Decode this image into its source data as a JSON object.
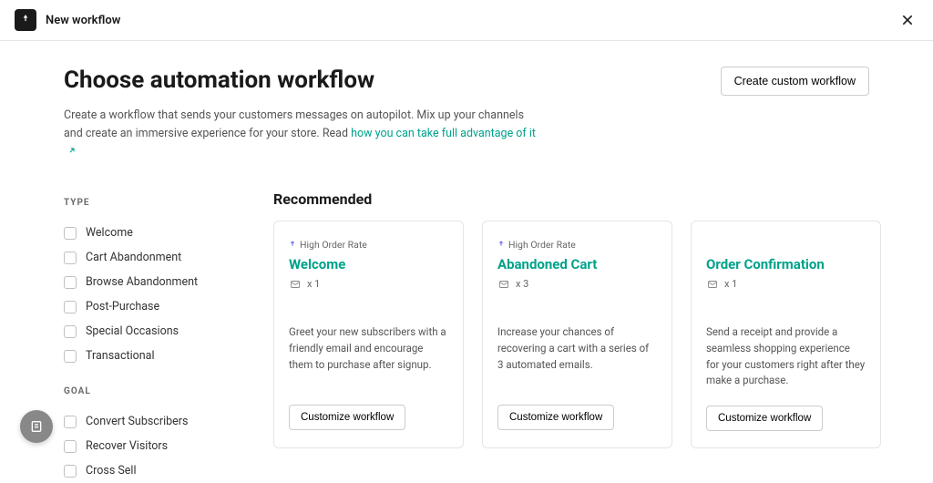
{
  "topbar": {
    "title": "New workflow"
  },
  "header": {
    "title": "Choose automation workflow",
    "desc_prefix": "Create a workflow that sends your customers messages on autopilot. Mix up your channels and create an immersive experience for your store. Read ",
    "link_text": "how you can take full advantage of it",
    "create_btn": "Create custom workflow"
  },
  "sidebar": {
    "type_heading": "TYPE",
    "goal_heading": "GOAL",
    "type_items": [
      "Welcome",
      "Cart Abandonment",
      "Browse Abandonment",
      "Post-Purchase",
      "Special Occasions",
      "Transactional"
    ],
    "goal_items": [
      "Convert Subscribers",
      "Recover Visitors",
      "Cross Sell"
    ]
  },
  "main": {
    "section_heading": "Recommended",
    "cards": [
      {
        "badge": "High Order Rate",
        "title": "Welcome",
        "mail_count": "x 1",
        "desc": "Greet your new subscribers with a friendly email and encourage them to purchase after signup.",
        "btn": "Customize workflow"
      },
      {
        "badge": "High Order Rate",
        "title": "Abandoned Cart",
        "mail_count": "x 3",
        "desc": "Increase your chances of recovering a cart with a series of 3 automated emails.",
        "btn": "Customize workflow"
      },
      {
        "badge": "",
        "title": "Order Confirmation",
        "mail_count": "x 1",
        "desc": "Send a receipt and provide a seamless shopping experience for your customers right after they make a purchase.",
        "btn": "Customize workflow"
      }
    ]
  }
}
